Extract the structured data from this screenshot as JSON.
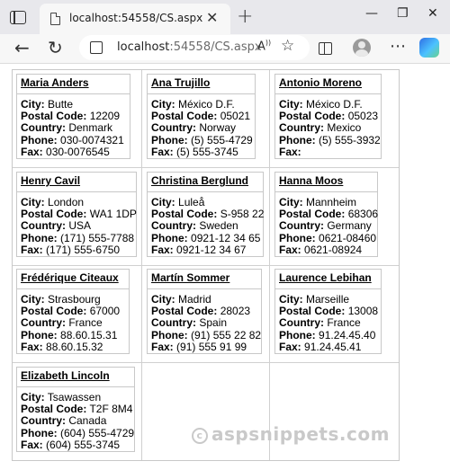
{
  "browser": {
    "tab_title": "localhost:54558/CS.aspx",
    "tab_close": "✕",
    "new_tab": "+",
    "window": {
      "minimize": "—",
      "restore": "❐",
      "close": "✕"
    },
    "address": {
      "host": "localhost",
      "rest": ":54558/CS.aspx"
    },
    "icons": [
      "tab-strip-icon",
      "page-icon",
      "back-icon",
      "refresh-icon",
      "site-info-icon",
      "read-aloud-icon",
      "favorite-star-icon",
      "split-screen-icon",
      "profile-avatar",
      "more-options-icon",
      "copilot-icon"
    ]
  },
  "labels": {
    "city": "City:",
    "postal": "Postal Code:",
    "country": "Country:",
    "phone": "Phone:",
    "fax": "Fax:"
  },
  "customers": [
    {
      "name": "Maria Anders",
      "city": "Butte",
      "postal": "12209",
      "country": "Denmark",
      "phone": "030-0074321",
      "fax": "030-0076545"
    },
    {
      "name": "Ana Trujillo",
      "city": "México D.F.",
      "postal": "05021",
      "country": "Norway",
      "phone": "(5) 555-4729",
      "fax": "(5) 555-3745"
    },
    {
      "name": "Antonio Moreno",
      "city": "México D.F.",
      "postal": "05023",
      "country": "Mexico",
      "phone": "(5) 555-3932",
      "fax": ""
    },
    {
      "name": "Henry Cavil",
      "city": "London",
      "postal": "WA1 1DP",
      "country": "USA",
      "phone": "(171) 555-7788",
      "fax": "(171) 555-6750"
    },
    {
      "name": "Christina Berglund",
      "city": "Luleå",
      "postal": "S-958 22",
      "country": "Sweden",
      "phone": "0921-12 34 65",
      "fax": "0921-12 34 67"
    },
    {
      "name": "Hanna Moos",
      "city": "Mannheim",
      "postal": "68306",
      "country": "Germany",
      "phone": "0621-08460",
      "fax": "0621-08924"
    },
    {
      "name": "Frédérique Citeaux",
      "city": "Strasbourg",
      "postal": "67000",
      "country": "France",
      "phone": "88.60.15.31",
      "fax": "88.60.15.32"
    },
    {
      "name": "Martín Sommer",
      "city": "Madrid",
      "postal": "28023",
      "country": "Spain",
      "phone": "(91) 555 22 82",
      "fax": "(91) 555 91 99"
    },
    {
      "name": "Laurence Lebihan",
      "city": "Marseille",
      "postal": "13008",
      "country": "France",
      "phone": "91.24.45.40",
      "fax": "91.24.45.41"
    },
    {
      "name": "Elizabeth Lincoln",
      "city": "Tsawassen",
      "postal": "T2F 8M4",
      "country": "Canada",
      "phone": "(604) 555-4729",
      "fax": "(604) 555-3745"
    }
  ],
  "watermark": {
    "symbol": "c",
    "text": "aspsnippets.com"
  }
}
